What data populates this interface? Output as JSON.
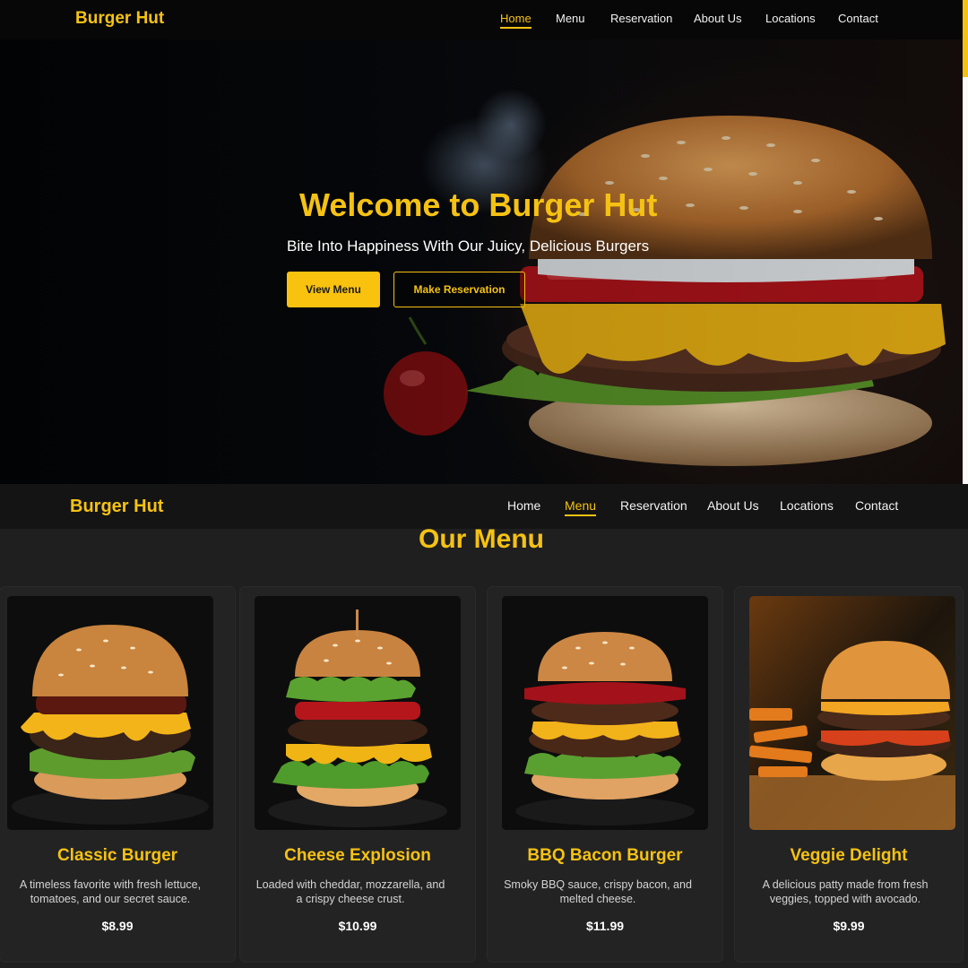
{
  "brand": "Burger Hut",
  "top_nav": {
    "items": [
      {
        "label": "Home",
        "active": true
      },
      {
        "label": "Menu",
        "active": false
      },
      {
        "label": "Reservation",
        "active": false
      },
      {
        "label": "About Us",
        "active": false
      },
      {
        "label": "Locations",
        "active": false
      },
      {
        "label": "Contact",
        "active": false
      }
    ]
  },
  "hero": {
    "title": "Welcome to Burger Hut",
    "subtitle": "Bite Into Happiness With Our Juicy, Delicious Burgers",
    "primary_button": "View Menu",
    "secondary_button": "Make Reservation"
  },
  "second_nav": {
    "items": [
      {
        "label": "Home",
        "active": false
      },
      {
        "label": "Menu",
        "active": true
      },
      {
        "label": "Reservation",
        "active": false
      },
      {
        "label": "About Us",
        "active": false
      },
      {
        "label": "Locations",
        "active": false
      },
      {
        "label": "Contact",
        "active": false
      }
    ]
  },
  "menu": {
    "title": "Our Menu",
    "items": [
      {
        "name": "Classic Burger",
        "description": "A timeless favorite with fresh lettuce, tomatoes, and our secret sauce.",
        "price": "$8.99"
      },
      {
        "name": "Cheese Explosion",
        "description": "Loaded with cheddar, mozzarella, and a crispy cheese crust.",
        "price": "$10.99"
      },
      {
        "name": "BBQ Bacon Burger",
        "description": "Smoky BBQ sauce, crispy bacon, and melted cheese.",
        "price": "$11.99"
      },
      {
        "name": "Veggie Delight",
        "description": "A delicious patty made from fresh veggies, topped with avocado.",
        "price": "$9.99"
      }
    ]
  },
  "colors": {
    "accent": "#f5c213",
    "nav_bg": "#070707",
    "page_bg": "#1f1f1f",
    "card_bg": "#232323"
  }
}
